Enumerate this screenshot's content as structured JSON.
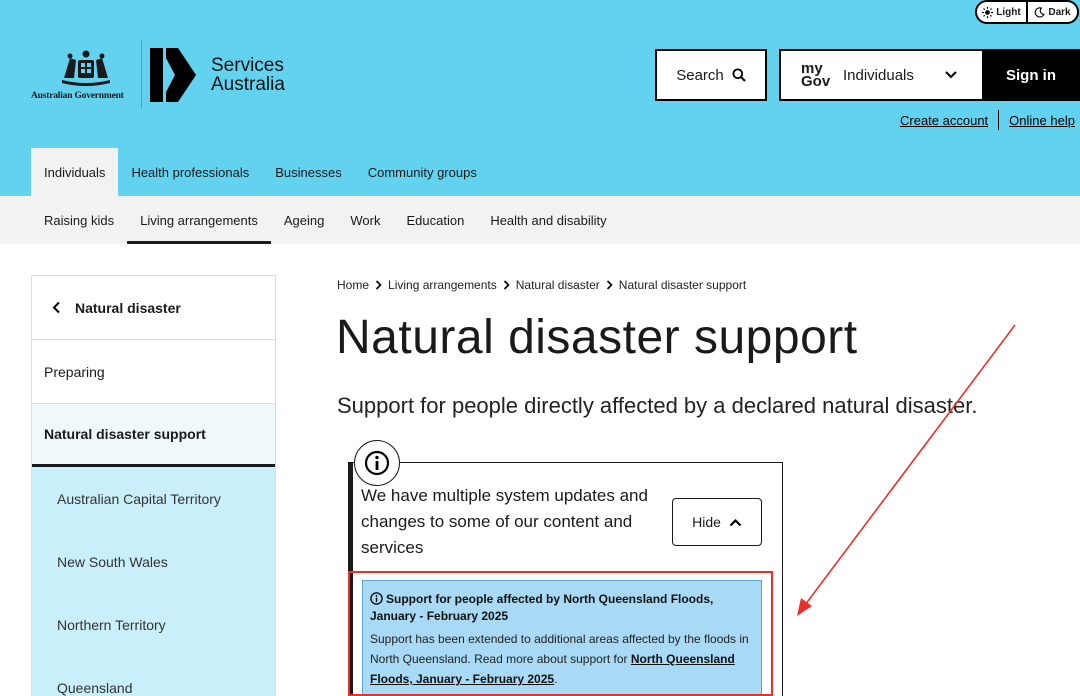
{
  "theme": {
    "light": "Light",
    "dark": "Dark"
  },
  "gov_logo_text": "Australian Government",
  "brand": {
    "line1": "Services",
    "line2": "Australia"
  },
  "search": {
    "label": "Search"
  },
  "mygov": {
    "brand_top": "my",
    "brand_bottom": "Gov",
    "selected": "Individuals"
  },
  "signin": "Sign in",
  "account_links": [
    "Create account",
    "Online help"
  ],
  "audience_tabs": [
    "Individuals",
    "Health professionals",
    "Businesses",
    "Community groups"
  ],
  "topic_nav": [
    "Raising kids",
    "Living arrangements",
    "Ageing",
    "Work",
    "Education",
    "Health and disability"
  ],
  "sidebar": {
    "back": "Natural disaster",
    "items": [
      "Preparing",
      "Natural disaster support"
    ],
    "sub_items": [
      "Australian Capital Territory",
      "New South Wales",
      "Northern Territory",
      "Queensland"
    ]
  },
  "breadcrumb": [
    "Home",
    "Living arrangements",
    "Natural disaster",
    "Natural disaster support"
  ],
  "page_title": "Natural disaster support",
  "lead": "Support for people directly affected by a declared natural disaster.",
  "notice": {
    "heading": "We have multiple system updates and changes to some of our content and services",
    "hide_label": "Hide"
  },
  "alert": {
    "title": "Support for people affected by North Queensland Floods, January - February 2025",
    "body": "Support has been extended to additional areas affected by the floods in North Queensland. Read more about support for ",
    "link": "North Queensland Floods, January - February 2025",
    "end": "."
  },
  "colors": {
    "header": "#63d2ef",
    "nav": "#f2f2f2",
    "sidebar_sub": "#c9effa",
    "alert": "#a8d9f5",
    "annotation": "#e8312b"
  }
}
